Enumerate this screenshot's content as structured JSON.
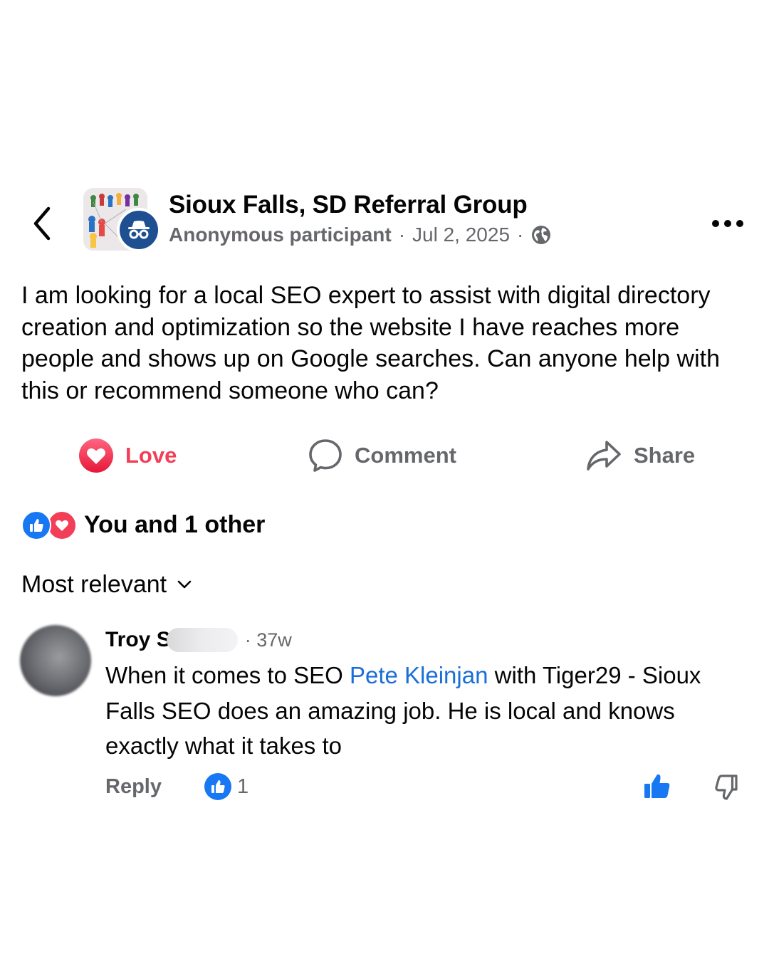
{
  "header": {
    "group_name": "Sioux Falls, SD Referral Group",
    "author": "Anonymous participant",
    "separator": "·",
    "date": "Jul 2, 2025",
    "audience_icon": "globe-icon"
  },
  "post": {
    "text": "I am looking for a local SEO expert to assist with digital directory creation and optimization so the website I have reaches more people and shows up on Google searches. Can anyone help with this or recommend someone who can?"
  },
  "actions": {
    "love_label": "Love",
    "comment_label": "Comment",
    "share_label": "Share"
  },
  "reactions": {
    "summary": "You and 1 other"
  },
  "sort": {
    "label": "Most relevant"
  },
  "comment": {
    "author_visible": "Troy S",
    "time": "· 37w",
    "text_before": "When it comes to SEO ",
    "mention": "Pete Kleinjan",
    "text_after": " with Tiger29 - Sioux Falls SEO does an amazing job. He is local and knows exactly what it takes to",
    "reply_label": "Reply",
    "like_count": "1"
  },
  "colors": {
    "love": "#f33e58",
    "like_blue": "#1877f2",
    "link_blue": "#1a6ed8",
    "secondary_text": "#65676b",
    "anon_badge": "#1d4f91"
  }
}
